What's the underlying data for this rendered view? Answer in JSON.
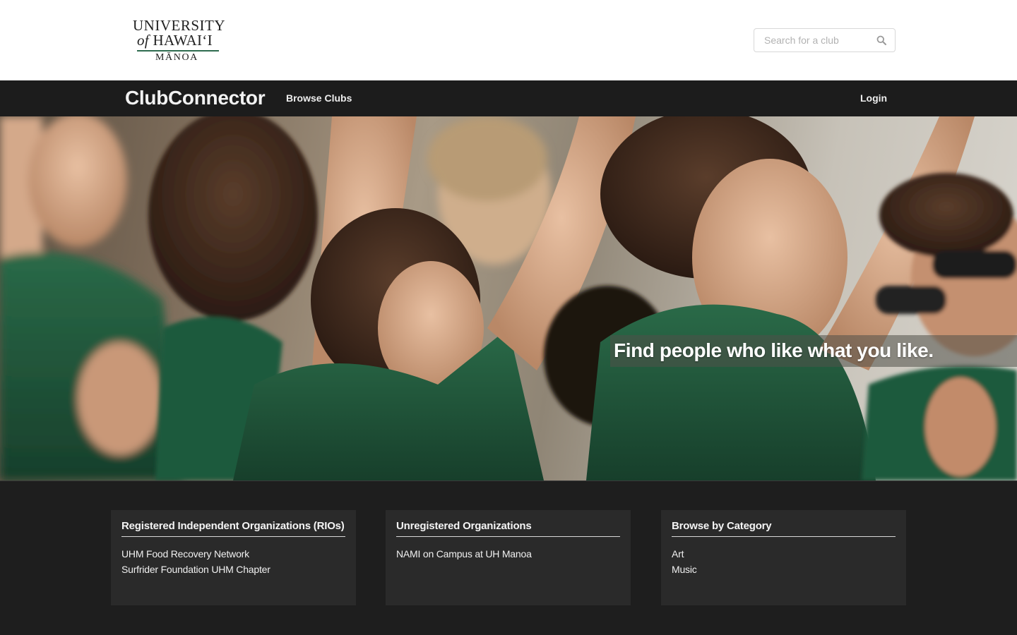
{
  "header": {
    "logo": {
      "line1": "UNIVERSITY",
      "line2_prefix": "of",
      "line2_main": "HAWAI‘I",
      "line3": "MĀNOA"
    },
    "search": {
      "placeholder": "Search for a club",
      "value": "",
      "icon": "search-icon"
    }
  },
  "nav": {
    "brand": "ClubConnector",
    "links": [
      {
        "label": "Browse Clubs"
      }
    ],
    "login_label": "Login"
  },
  "hero": {
    "tagline": "Find people who like what you like."
  },
  "panels": [
    {
      "title": "Registered Independent Organizations (RIOs)",
      "items": [
        "UHM Food Recovery Network",
        "Surfrider Foundation UHM Chapter"
      ]
    },
    {
      "title": "Unregistered Organizations",
      "items": [
        "NAMI on Campus at UH Manoa"
      ]
    },
    {
      "title": "Browse by Category",
      "items": [
        "Art",
        "Music"
      ]
    }
  ],
  "colors": {
    "nav_bg": "#1c1c1c",
    "page_bg": "#1e1e1e",
    "panel_bg": "#2a2a2a",
    "shirt_green": "#1f5a3c",
    "logo_rule": "#2e6b4f"
  }
}
